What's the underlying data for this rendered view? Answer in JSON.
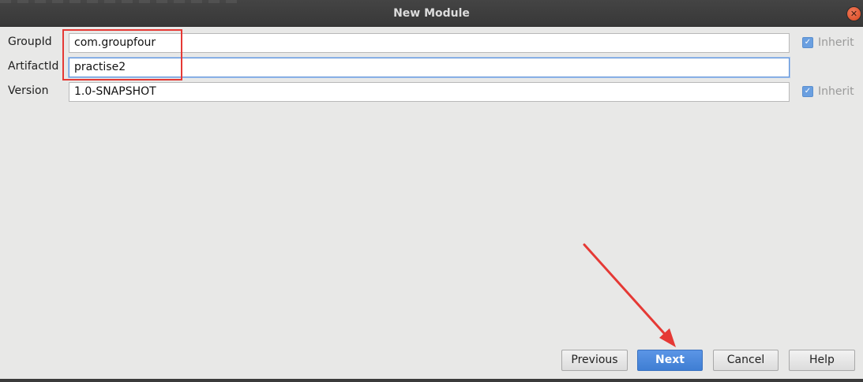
{
  "window": {
    "title": "New Module",
    "close_icon": "close-icon"
  },
  "form": {
    "group_id": {
      "label": "GroupId",
      "value": "com.groupfour",
      "inherit_label": "Inherit",
      "inherit_checked": true
    },
    "artifact_id": {
      "label": "ArtifactId",
      "value": "practise2"
    },
    "version": {
      "label": "Version",
      "value": "1.0-SNAPSHOT",
      "inherit_label": "Inherit",
      "inherit_checked": true
    }
  },
  "buttons": {
    "previous": "Previous",
    "next": "Next",
    "cancel": "Cancel",
    "help": "Help"
  },
  "annotations": {
    "highlight_color": "#e53935",
    "arrow_color": "#e53935"
  },
  "colors": {
    "accent": "#4a86d8",
    "background": "#e8e8e7",
    "titlebar": "#3c3c3c"
  }
}
